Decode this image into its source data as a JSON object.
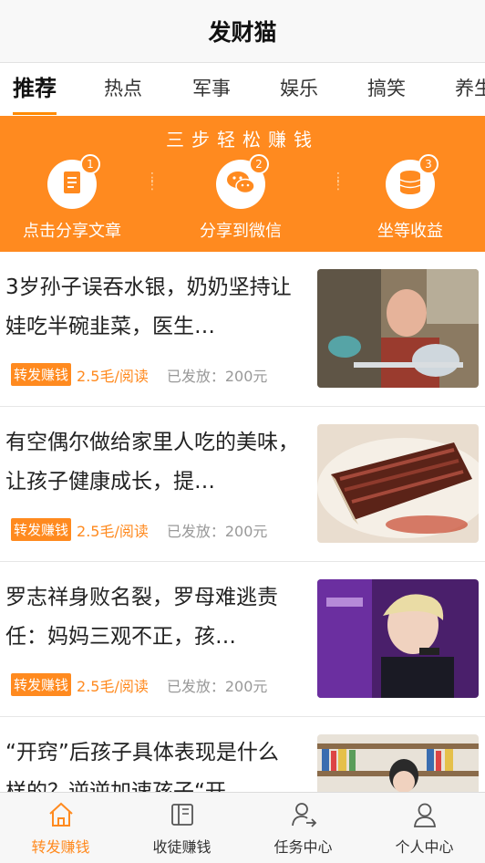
{
  "app": {
    "title": "发财猫"
  },
  "tabs": [
    {
      "label": "推荐",
      "active": true
    },
    {
      "label": "热点"
    },
    {
      "label": "军事"
    },
    {
      "label": "娱乐"
    },
    {
      "label": "搞笑"
    },
    {
      "label": "养生"
    }
  ],
  "banner": {
    "title": "三步轻松赚钱",
    "steps": [
      {
        "num": "1",
        "label": "点击分享文章",
        "icon": "document-icon"
      },
      {
        "num": "2",
        "label": "分享到微信",
        "icon": "wechat-icon"
      },
      {
        "num": "3",
        "label": "坐等收益",
        "icon": "coins-icon"
      }
    ]
  },
  "articles": [
    {
      "headline": "3岁孙子误吞水银，奶奶坚持让娃吃半碗韭菜，医生…",
      "badge": "转发赚钱",
      "price": "2.5毛/阅读",
      "sent": "已发放：200元"
    },
    {
      "headline": "有空偶尔做给家里人吃的美味，让孩子健康成长，提…",
      "badge": "转发赚钱",
      "price": "2.5毛/阅读",
      "sent": "已发放：200元"
    },
    {
      "headline": "罗志祥身败名裂，罗母难逃责任：妈妈三观不正，孩…",
      "badge": "转发赚钱",
      "price": "2.5毛/阅读",
      "sent": "已发放：200元"
    },
    {
      "headline": "“开窍”后孩子具体表现是什么样的？逆逆加速孩子“开",
      "badge": "",
      "price": "",
      "sent": ""
    }
  ],
  "tabbar": [
    {
      "label": "转发赚钱",
      "active": true,
      "icon": "home-icon"
    },
    {
      "label": "收徒赚钱",
      "icon": "book-icon"
    },
    {
      "label": "任务中心",
      "icon": "user-share-icon"
    },
    {
      "label": "个人中心",
      "icon": "person-icon"
    }
  ],
  "colors": {
    "accent": "#ff8a1f",
    "text": "#222222",
    "muted": "#999999"
  }
}
